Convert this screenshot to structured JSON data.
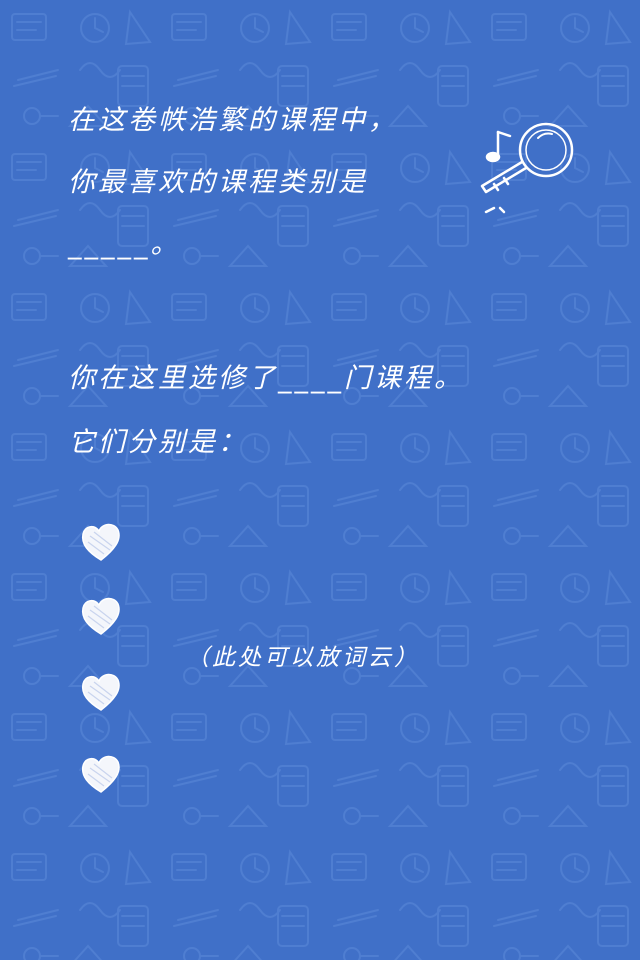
{
  "background": {
    "color": "#4070c8",
    "pattern_color": "#5a88d8",
    "pattern": "school-doodle"
  },
  "text": {
    "line1": "在这卷帙浩繁的课程中，",
    "line2": "你最喜欢的课程类别是",
    "line3": "_____。",
    "line4": "你在这里选修了____门课程。",
    "line5": "它们分别是："
  },
  "note": "（此处可以放词云）",
  "icons": {
    "magnifier": "magnifier-icon",
    "music_note": "music-note-icon",
    "bullet": "heart-icon"
  },
  "text_color": "#ffffff"
}
